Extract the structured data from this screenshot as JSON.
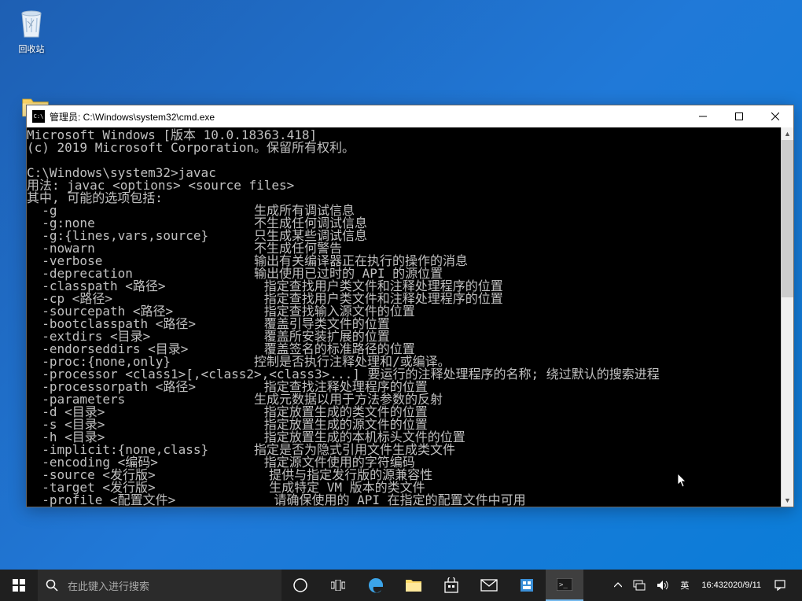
{
  "desktop": {
    "recycle_label": "回收站"
  },
  "cmd": {
    "title": "管理员: C:\\Windows\\system32\\cmd.exe",
    "header1": "Microsoft Windows [版本 10.0.18363.418]",
    "header2": "(c) 2019 Microsoft Corporation。保留所有权利。",
    "prompt": "C:\\Windows\\system32>javac",
    "usage": "用法: javac <options> <source files>",
    "where": "其中, 可能的选项包括:",
    "options": [
      {
        "flag": "-g",
        "desc": "生成所有调试信息"
      },
      {
        "flag": "-g:none",
        "desc": "不生成任何调试信息"
      },
      {
        "flag": "-g:{lines,vars,source}",
        "desc": "只生成某些调试信息"
      },
      {
        "flag": "-nowarn",
        "desc": "不生成任何警告"
      },
      {
        "flag": "-verbose",
        "desc": "输出有关编译器正在执行的操作的消息"
      },
      {
        "flag": "-deprecation",
        "desc": "输出使用已过时的 API 的源位置"
      },
      {
        "flag": "-classpath <路径>",
        "desc": "指定查找用户类文件和注释处理程序的位置"
      },
      {
        "flag": "-cp <路径>",
        "desc": "指定查找用户类文件和注释处理程序的位置"
      },
      {
        "flag": "-sourcepath <路径>",
        "desc": "指定查找输入源文件的位置"
      },
      {
        "flag": "-bootclasspath <路径>",
        "desc": "覆盖引导类文件的位置"
      },
      {
        "flag": "-extdirs <目录>",
        "desc": "覆盖所安装扩展的位置"
      },
      {
        "flag": "-endorseddirs <目录>",
        "desc": "覆盖签名的标准路径的位置"
      },
      {
        "flag": "-proc:{none,only}",
        "desc": "控制是否执行注释处理和/或编译。"
      },
      {
        "flag": "-processor <class1>[,<class2>,<class3>...] 要运行的注释处理程序的名称; 绕过默认的搜索进程",
        "desc": ""
      },
      {
        "flag": "-processorpath <路径>",
        "desc": "指定查找注释处理程序的位置"
      },
      {
        "flag": "-parameters",
        "desc": "生成元数据以用于方法参数的反射"
      },
      {
        "flag": "-d <目录>",
        "desc": "指定放置生成的类文件的位置"
      },
      {
        "flag": "-s <目录>",
        "desc": "指定放置生成的源文件的位置"
      },
      {
        "flag": "-h <目录>",
        "desc": "指定放置生成的本机标头文件的位置"
      },
      {
        "flag": "-implicit:{none,class}",
        "desc": "指定是否为隐式引用文件生成类文件"
      },
      {
        "flag": "-encoding <编码>",
        "desc": "指定源文件使用的字符编码"
      },
      {
        "flag": "-source <发行版>",
        "desc": "提供与指定发行版的源兼容性"
      },
      {
        "flag": "-target <发行版>",
        "desc": "生成特定 VM 版本的类文件"
      },
      {
        "flag": "-profile <配置文件>",
        "desc": "请确保使用的 API 在指定的配置文件中可用"
      }
    ]
  },
  "taskbar": {
    "search_placeholder": "在此键入进行搜索",
    "ime_label": "英",
    "time": "16:43",
    "date": "2020/9/11"
  }
}
